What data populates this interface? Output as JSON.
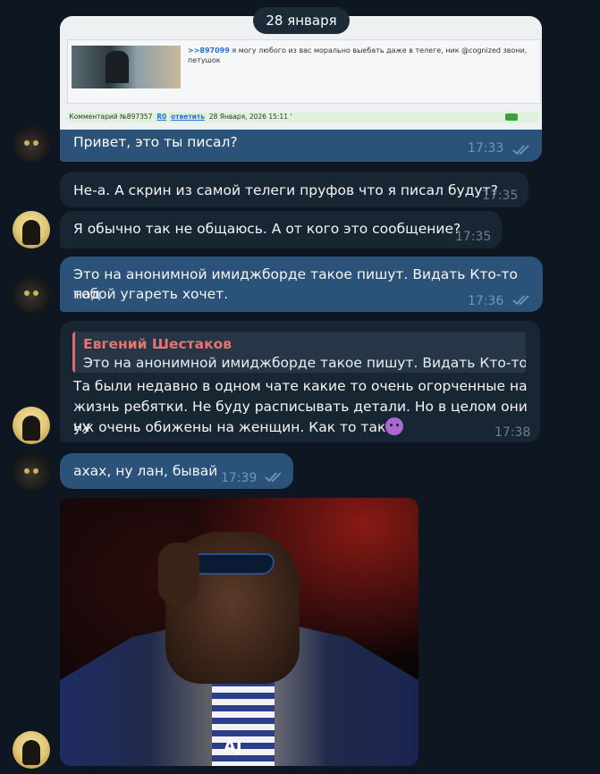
{
  "date_separator": "28 января",
  "screenshot_message": {
    "post_link": ">>897099",
    "post_text": "я могу любого из вас морально выебать даже в телеге, ник @cognized звони, петушок",
    "comment_prefix": "Комментарий №897357",
    "comment_r0": "R0",
    "comment_reply": "ответить",
    "comment_date": "28 Января, 2026 15:11 '",
    "caption": "Привет, это ты писал?",
    "time": "17:33"
  },
  "messages": [
    {
      "text": "Не-а. А скрин из самой телеги пруфов что я писал будут?",
      "time": "17:35"
    },
    {
      "text": "Я обычно так не общаюсь. А от кого это сообщение?",
      "time": "17:35"
    },
    {
      "text_line1": "Это на анонимной имиджборде такое пишут. Видать Кто-то над",
      "text_line2": "тобой угареть хочет.",
      "time": "17:36"
    },
    {
      "text_line1": "Та были недавно в одном чате какие то очень огорченные на",
      "text_line2": "жизнь ребятки. Не буду расписывать детали. Но в целом они ну",
      "text_line3": "уж очень обижены на женщин. Как то так",
      "time": "17:38"
    },
    {
      "text": "ахах, ну лан, бывай",
      "time": "17:39"
    }
  ],
  "reply": {
    "name": "Евгений Шестаков",
    "quoted": "Это на анонимной имиджборде такое пишут. Видать Кто-то ..."
  },
  "gif": {
    "watermark": "AJ"
  },
  "colors": {
    "background": "#0e1621",
    "outgoing": "#2b5278",
    "incoming": "#182533",
    "reply_name": "#e8736f"
  }
}
